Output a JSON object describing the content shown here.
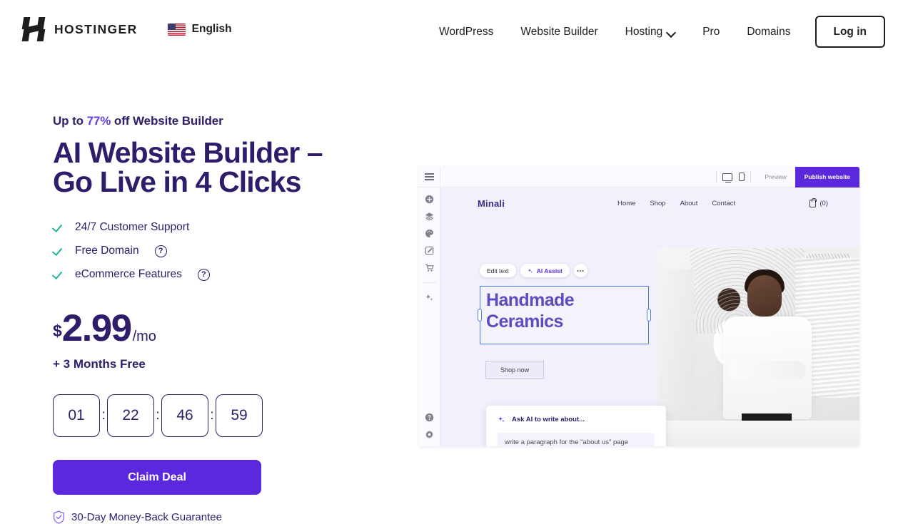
{
  "header": {
    "logo_word": "HOSTINGER",
    "logo_icon": "hostinger-h-logo",
    "language": {
      "label": "English",
      "flag": "us-flag-icon"
    },
    "nav": [
      {
        "label": "WordPress",
        "caret": false
      },
      {
        "label": "Website Builder",
        "caret": false
      },
      {
        "label": "Hosting",
        "caret": true
      },
      {
        "label": "Pro",
        "caret": false
      },
      {
        "label": "Domains",
        "caret": false
      }
    ],
    "login_label": "Log in"
  },
  "promo": {
    "eyebrow_pre": "Up to ",
    "eyebrow_pct": "77%",
    "eyebrow_post": " off Website Builder",
    "headline": "AI Website Builder – Go Live in 4 Clicks",
    "features": [
      {
        "label": "24/7 Customer Support",
        "help": false
      },
      {
        "label": "Free Domain",
        "help": true
      },
      {
        "label": "eCommerce Features",
        "help": true
      }
    ],
    "help_glyph": "?",
    "price": {
      "currency": "$",
      "amount": "2.99",
      "period": "/mo"
    },
    "bonus": "+ 3 Months Free",
    "countdown": {
      "days": "01",
      "hours": "22",
      "minutes": "46",
      "seconds": "59",
      "separator": ":"
    },
    "cta_label": "Claim Deal",
    "guarantee": "30-Day Money-Back Guarantee",
    "colors": {
      "accent": "#5b28dd",
      "heading": "#2f1c6a",
      "check": "#20b699",
      "pct": "#673de6"
    }
  },
  "builder": {
    "topbar": {
      "menu_icon": "hamburger-icon",
      "desktop_icon": "desktop-view-icon",
      "mobile_icon": "mobile-view-icon",
      "preview_label": "Preview",
      "publish_label": "Publish website"
    },
    "sidebar": [
      {
        "icon": "add-element-icon"
      },
      {
        "icon": "layers-icon"
      },
      {
        "icon": "palette-icon"
      },
      {
        "icon": "edit-pencil-icon"
      },
      {
        "icon": "shopping-cart-icon"
      },
      {
        "icon": "ai-sparkle-icon"
      }
    ],
    "sidebar_bottom": [
      {
        "icon": "help-circle-icon"
      },
      {
        "icon": "settings-gear-icon"
      }
    ],
    "site": {
      "logo": "Minali",
      "links": [
        "Home",
        "Shop",
        "About",
        "Contact"
      ],
      "cart_count": "(0)",
      "cart_icon": "shopping-bag-icon"
    },
    "edit_toolbar": {
      "edit_text_label": "Edit text",
      "ai_assist_label": "AI Assist",
      "ai_icon": "ai-sparkle-icon",
      "more_label": "•••"
    },
    "hero_title": "Handmade Ceramics",
    "shop_now_label": "Shop now",
    "hero_image_alt": "ceramics-studio-photo",
    "ai_panel": {
      "title": "Ask AI to write about...",
      "icon": "ai-sparkle-icon",
      "input_value": "write a paragraph for the \"about us\" page"
    }
  }
}
